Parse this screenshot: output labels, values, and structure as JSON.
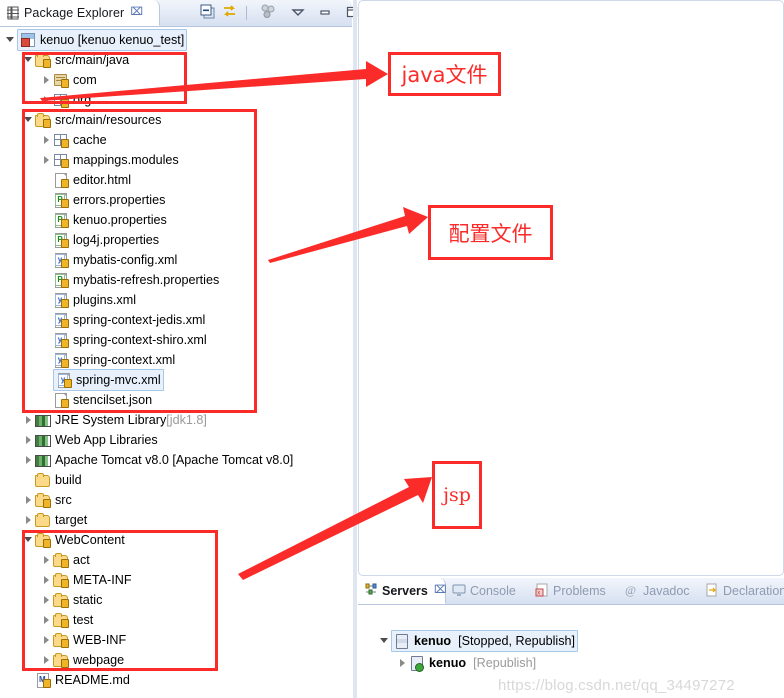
{
  "explorer": {
    "tab_label": "Package Explorer",
    "tab_close": "⌧",
    "toolbar": [
      {
        "name": "collapse-all-icon",
        "title": "Collapse All"
      },
      {
        "name": "link-with-editor-icon",
        "title": "Link with Editor"
      },
      {
        "name": "view-menu-icon",
        "title": "View Menu"
      },
      {
        "name": "minimize-icon",
        "title": "Minimize"
      },
      {
        "name": "maximize-icon",
        "title": "Maximize"
      }
    ],
    "tree": [
      {
        "id": "prj",
        "label": "kenuo [kenuo kenuo_test]",
        "suffix": "",
        "indent": 0,
        "toggle": "expanded",
        "icon": "project",
        "selected": true
      },
      {
        "id": "srcmainjava",
        "label": "src/main/java",
        "suffix": "",
        "indent": 1,
        "toggle": "expanded",
        "icon": "srcfolder",
        "selected": false
      },
      {
        "id": "com",
        "label": "com",
        "suffix": "",
        "indent": 2,
        "toggle": "collapsed",
        "icon": "pkg-java",
        "selected": false
      },
      {
        "id": "org",
        "label": "org",
        "suffix": "",
        "indent": 2,
        "toggle": "collapsed",
        "icon": "pkg-grid",
        "selected": false
      },
      {
        "id": "srcmainres",
        "label": "src/main/resources",
        "suffix": "",
        "indent": 1,
        "toggle": "expanded",
        "icon": "srcfolder",
        "selected": false
      },
      {
        "id": "cache",
        "label": "cache",
        "suffix": "",
        "indent": 2,
        "toggle": "collapsed",
        "icon": "pkg-grid",
        "selected": false
      },
      {
        "id": "mappings",
        "label": "mappings.modules",
        "suffix": "",
        "indent": 2,
        "toggle": "collapsed",
        "icon": "pkg-grid",
        "selected": false
      },
      {
        "id": "editorhtml",
        "label": "editor.html",
        "suffix": "",
        "indent": 2,
        "toggle": "none",
        "icon": "file-html",
        "selected": false
      },
      {
        "id": "errorsprops",
        "label": "errors.properties",
        "suffix": "",
        "indent": 2,
        "toggle": "none",
        "icon": "file-properties",
        "selected": false
      },
      {
        "id": "kenuoprops",
        "label": "kenuo.properties",
        "suffix": "",
        "indent": 2,
        "toggle": "none",
        "icon": "file-properties",
        "selected": false
      },
      {
        "id": "log4jprops",
        "label": "log4j.properties",
        "suffix": "",
        "indent": 2,
        "toggle": "none",
        "icon": "file-properties",
        "selected": false
      },
      {
        "id": "mybatiscfg",
        "label": "mybatis-config.xml",
        "suffix": "",
        "indent": 2,
        "toggle": "none",
        "icon": "file-xml",
        "selected": false
      },
      {
        "id": "mybatisrefresh",
        "label": "mybatis-refresh.properties",
        "suffix": "",
        "indent": 2,
        "toggle": "none",
        "icon": "file-properties",
        "selected": false
      },
      {
        "id": "pluginsxml",
        "label": "plugins.xml",
        "suffix": "",
        "indent": 2,
        "toggle": "none",
        "icon": "file-xml",
        "selected": false
      },
      {
        "id": "ctxjedis",
        "label": "spring-context-jedis.xml",
        "suffix": "",
        "indent": 2,
        "toggle": "none",
        "icon": "file-xml",
        "selected": false
      },
      {
        "id": "ctxshiro",
        "label": "spring-context-shiro.xml",
        "suffix": "",
        "indent": 2,
        "toggle": "none",
        "icon": "file-xml",
        "selected": false
      },
      {
        "id": "ctxxml",
        "label": "spring-context.xml",
        "suffix": "",
        "indent": 2,
        "toggle": "none",
        "icon": "file-xml",
        "selected": false
      },
      {
        "id": "springmvc",
        "label": "spring-mvc.xml",
        "suffix": "",
        "indent": 2,
        "toggle": "none",
        "icon": "file-xml",
        "selected": true
      },
      {
        "id": "stencilset",
        "label": "stencilset.json",
        "suffix": "",
        "indent": 2,
        "toggle": "none",
        "icon": "file-html",
        "selected": false
      },
      {
        "id": "jre",
        "label": "JRE System Library ",
        "suffix": "[jdk1.8]",
        "indent": 1,
        "toggle": "collapsed",
        "icon": "library",
        "selected": false
      },
      {
        "id": "webapplibs",
        "label": "Web App Libraries",
        "suffix": "",
        "indent": 1,
        "toggle": "collapsed",
        "icon": "library",
        "selected": false
      },
      {
        "id": "tomcat",
        "label": "Apache Tomcat v8.0 [Apache Tomcat v8.0]",
        "suffix": "",
        "indent": 1,
        "toggle": "collapsed",
        "icon": "library",
        "selected": false
      },
      {
        "id": "build",
        "label": "build",
        "suffix": "",
        "indent": 1,
        "toggle": "none",
        "icon": "folder",
        "selected": false
      },
      {
        "id": "src",
        "label": "src",
        "suffix": "",
        "indent": 1,
        "toggle": "collapsed",
        "icon": "srcfolder",
        "selected": false
      },
      {
        "id": "target",
        "label": "target",
        "suffix": "",
        "indent": 1,
        "toggle": "collapsed",
        "icon": "folder",
        "selected": false
      },
      {
        "id": "webcontent",
        "label": "WebContent",
        "suffix": "",
        "indent": 1,
        "toggle": "expanded",
        "icon": "srcfolder",
        "selected": false
      },
      {
        "id": "act",
        "label": "act",
        "suffix": "",
        "indent": 2,
        "toggle": "collapsed",
        "icon": "srcfolder",
        "selected": false
      },
      {
        "id": "metainf",
        "label": "META-INF",
        "suffix": "",
        "indent": 2,
        "toggle": "collapsed",
        "icon": "srcfolder",
        "selected": false
      },
      {
        "id": "static",
        "label": "static",
        "suffix": "",
        "indent": 2,
        "toggle": "collapsed",
        "icon": "srcfolder",
        "selected": false
      },
      {
        "id": "test",
        "label": "test",
        "suffix": "",
        "indent": 2,
        "toggle": "collapsed",
        "icon": "srcfolder",
        "selected": false
      },
      {
        "id": "webinf",
        "label": "WEB-INF",
        "suffix": "",
        "indent": 2,
        "toggle": "collapsed",
        "icon": "srcfolder",
        "selected": false
      },
      {
        "id": "webpage",
        "label": "webpage",
        "suffix": "",
        "indent": 2,
        "toggle": "collapsed",
        "icon": "srcfolder",
        "selected": false
      },
      {
        "id": "readme",
        "label": "README.md",
        "suffix": "",
        "indent": 1,
        "toggle": "none",
        "icon": "file-md",
        "selected": false
      }
    ]
  },
  "bottom": {
    "tabs": [
      {
        "id": "servers",
        "label": "Servers",
        "icon": "servers-icon",
        "active": true,
        "close": "⌧"
      },
      {
        "id": "console",
        "label": "Console",
        "icon": "console-icon",
        "active": false,
        "close": ""
      },
      {
        "id": "problems",
        "label": "Problems",
        "icon": "problems-icon",
        "active": false,
        "close": ""
      },
      {
        "id": "javadoc",
        "label": "Javadoc",
        "icon": "javadoc-icon",
        "active": false,
        "close": ""
      },
      {
        "id": "declaration",
        "label": "Declaration",
        "icon": "declaration-icon",
        "active": false,
        "close": ""
      }
    ],
    "rows": [
      {
        "id": "srv-root",
        "name": "kenuo",
        "status": "[Stopped, Republish]",
        "toggle": "expanded",
        "indent": 0,
        "selected": true,
        "icon": "server-icon"
      },
      {
        "id": "srv-child",
        "name": "kenuo",
        "status": "[Republish]",
        "toggle": "collapsed",
        "indent": 1,
        "selected": false,
        "icon": "server-module-icon"
      }
    ],
    "watermark": "https://blog.csdn.net/qq_34497272"
  },
  "annotations": {
    "accent_color": "#fa2b29",
    "labels": [
      {
        "id": "java-label",
        "text": "java文件",
        "style": "cn"
      },
      {
        "id": "config-label",
        "text": "配置文件",
        "style": "cn"
      },
      {
        "id": "jsp-label",
        "text": "jsp",
        "style": "en"
      }
    ]
  }
}
